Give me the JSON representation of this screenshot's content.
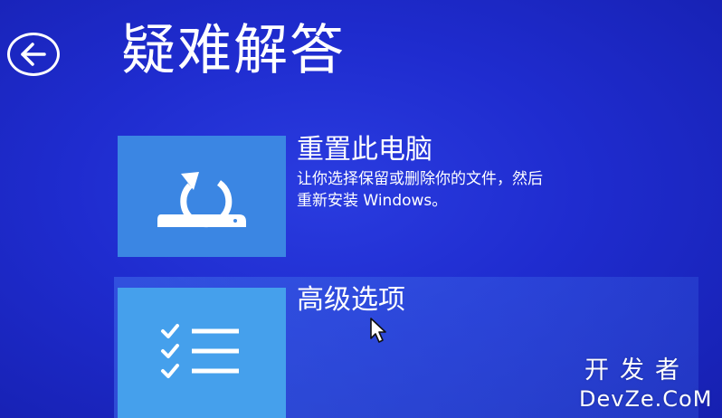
{
  "header": {
    "back_icon": "arrow-left-icon",
    "title": "疑难解答"
  },
  "options": [
    {
      "icon": "reset-pc-icon",
      "title": "重置此电脑",
      "description_line1": "让你选择保留或删除你的文件，然后",
      "description_line2": "重新安装 Windows。"
    },
    {
      "icon": "checklist-icon",
      "title": "高级选项"
    }
  ],
  "watermark": {
    "line1": "开发者",
    "line2": "DevZe.CoM"
  },
  "colors": {
    "background": "#1f2ccf",
    "tile_reset": "#3b86e3",
    "tile_advanced": "#45a0ec",
    "text": "#ffffff"
  }
}
